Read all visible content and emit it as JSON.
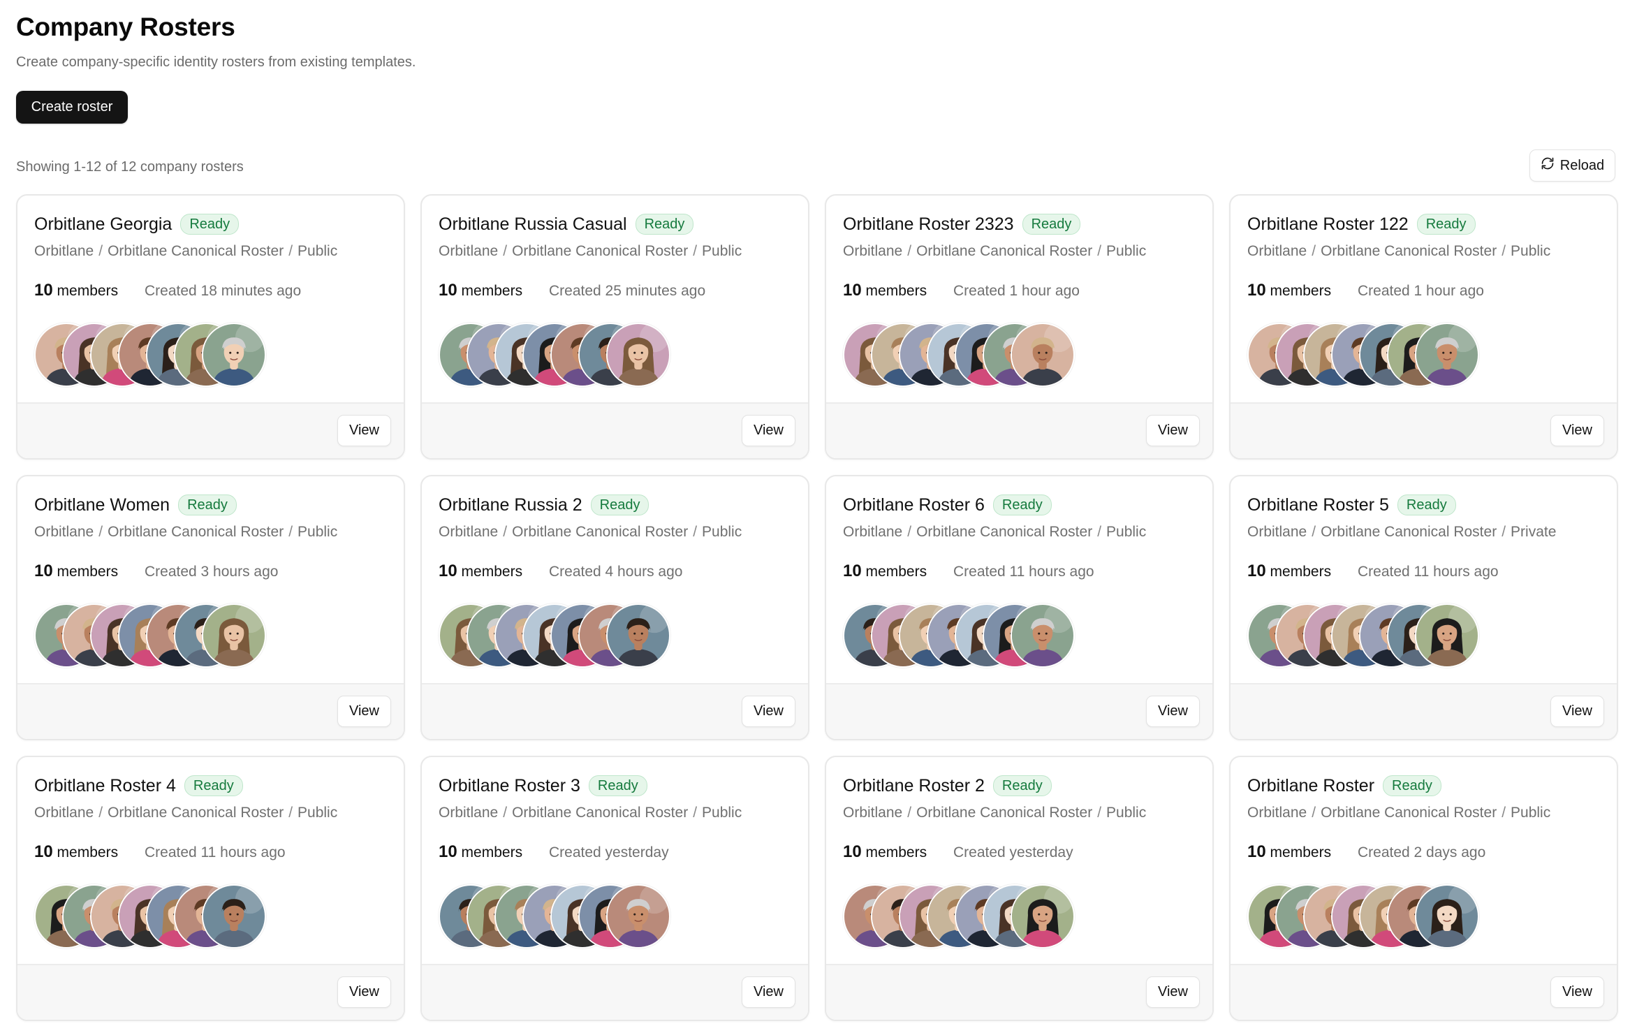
{
  "header": {
    "title": "Company Rosters",
    "subtitle": "Create company-specific identity rosters from existing templates.",
    "create_label": "Create roster"
  },
  "toolbar": {
    "showing_text": "Showing 1-12 of 12 company rosters",
    "reload_label": "Reload",
    "reload_icon": "refresh-icon"
  },
  "card_labels": {
    "status": "Ready",
    "members_suffix": "members",
    "view_label": "View",
    "separator": "/"
  },
  "colors": {
    "primary_button": "#141414",
    "badge_text": "#157a3d",
    "badge_bg": "#e6f6ea",
    "muted_text": "#707070",
    "card_border": "#e8e8e8",
    "footer_bg": "#f7f7f7"
  },
  "rosters": [
    {
      "name": "Orbitlane Georgia",
      "org": "Orbitlane",
      "template": "Orbitlane Canonical Roster",
      "visibility": "Public",
      "member_count": "10",
      "created": "Created 18 minutes ago",
      "avatar_count": 7
    },
    {
      "name": "Orbitlane Russia Casual",
      "org": "Orbitlane",
      "template": "Orbitlane Canonical Roster",
      "visibility": "Public",
      "member_count": "10",
      "created": "Created 25 minutes ago",
      "avatar_count": 7
    },
    {
      "name": "Orbitlane Roster 2323",
      "org": "Orbitlane",
      "template": "Orbitlane Canonical Roster",
      "visibility": "Public",
      "member_count": "10",
      "created": "Created 1 hour ago",
      "avatar_count": 7
    },
    {
      "name": "Orbitlane Roster 122",
      "org": "Orbitlane",
      "template": "Orbitlane Canonical Roster",
      "visibility": "Public",
      "member_count": "10",
      "created": "Created 1 hour ago",
      "avatar_count": 7
    },
    {
      "name": "Orbitlane Women",
      "org": "Orbitlane",
      "template": "Orbitlane Canonical Roster",
      "visibility": "Public",
      "member_count": "10",
      "created": "Created 3 hours ago",
      "avatar_count": 7
    },
    {
      "name": "Orbitlane Russia 2",
      "org": "Orbitlane",
      "template": "Orbitlane Canonical Roster",
      "visibility": "Public",
      "member_count": "10",
      "created": "Created 4 hours ago",
      "avatar_count": 7
    },
    {
      "name": "Orbitlane Roster 6",
      "org": "Orbitlane",
      "template": "Orbitlane Canonical Roster",
      "visibility": "Public",
      "member_count": "10",
      "created": "Created 11 hours ago",
      "avatar_count": 7
    },
    {
      "name": "Orbitlane Roster 5",
      "org": "Orbitlane",
      "template": "Orbitlane Canonical Roster",
      "visibility": "Private",
      "member_count": "10",
      "created": "Created 11 hours ago",
      "avatar_count": 7
    },
    {
      "name": "Orbitlane Roster 4",
      "org": "Orbitlane",
      "template": "Orbitlane Canonical Roster",
      "visibility": "Public",
      "member_count": "10",
      "created": "Created 11 hours ago",
      "avatar_count": 7
    },
    {
      "name": "Orbitlane Roster 3",
      "org": "Orbitlane",
      "template": "Orbitlane Canonical Roster",
      "visibility": "Public",
      "member_count": "10",
      "created": "Created yesterday",
      "avatar_count": 7
    },
    {
      "name": "Orbitlane Roster 2",
      "org": "Orbitlane",
      "template": "Orbitlane Canonical Roster",
      "visibility": "Public",
      "member_count": "10",
      "created": "Created yesterday",
      "avatar_count": 7
    },
    {
      "name": "Orbitlane Roster",
      "org": "Orbitlane",
      "template": "Orbitlane Canonical Roster",
      "visibility": "Public",
      "member_count": "10",
      "created": "Created 2 days ago",
      "avatar_count": 7
    }
  ]
}
